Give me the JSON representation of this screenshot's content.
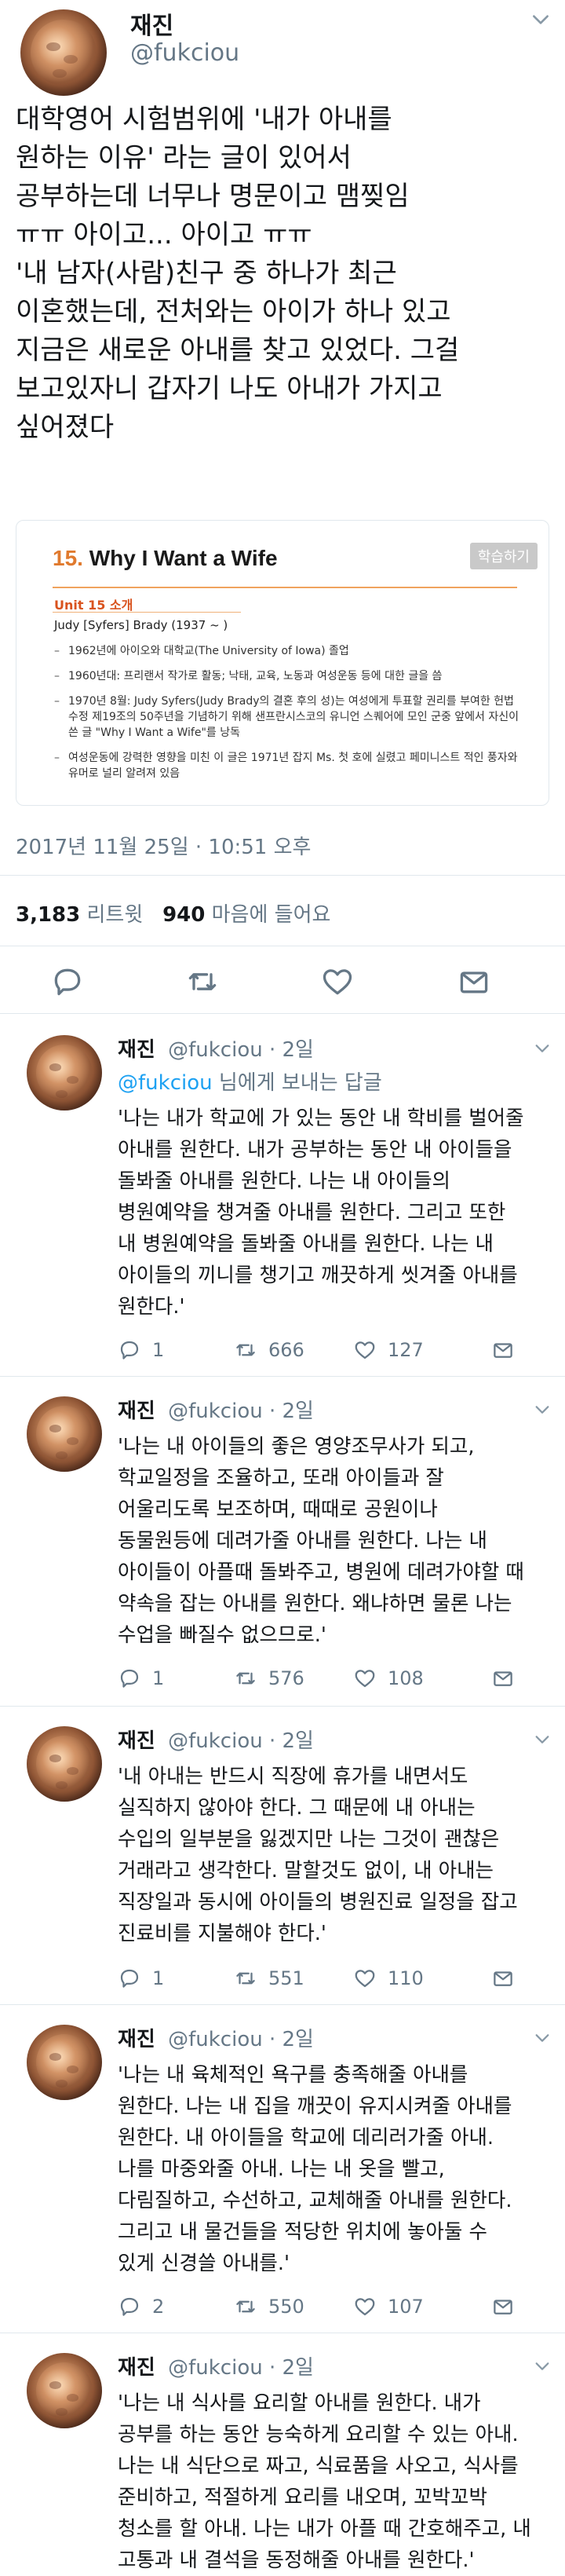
{
  "main_tweet": {
    "name": "재진",
    "handle": "@fukciou",
    "text": "대학영어 시험범위에 '내가 아내를\n원하는 이유' 라는 글이 있어서\n공부하는데 너무나 명문이고 맴찢임\nㅠㅠ 아이고... 아이고 ㅠㅠ\n'내 남자(사람)친구 중 하나가 최근\n이혼했는데, 전처와는 아이가 하나 있고\n지금은 새로운 아내를 찾고 있었다. 그걸\n보고있자니 갑자기 나도 아내가 가지고\n싶어졌다",
    "card": {
      "title_num": "15.",
      "title_text": "Why I Want a Wife",
      "tag": "학습하기",
      "unit": "Unit 15 소개",
      "author": "Judy [Syfers] Brady (1937 ~ )",
      "items": [
        "1962년에 아이오와 대학교(The University of Iowa) 졸업",
        "1960년대: 프리랜서 작가로 활동; 낙태, 교육, 노동과 여성운동 등에 대한 글을 씀",
        "1970년 8월: Judy Syfers(Judy Brady의 결혼 후의 성)는 여성에게 투표할 권리를 부여한 헌법 수정 제19조의 50주년을 기념하기 위해 샌프란시스코의 유니언 스퀘어에 모인 군중 앞에서 자신이 쓴 글 \"Why I Want a Wife\"를 낭독",
        "여성운동에 강력한 영향을 미친 이 글은 1971년 잡지 Ms. 첫 호에 실렸고 페미니스트 적인 풍자와 유머로 널리 알려져 있음"
      ]
    },
    "timestamp": "2017년 11월 25일 · 10:51 오후",
    "retweet_count": "3,183",
    "retweet_label": "리트윗",
    "like_count": "940",
    "like_label": "마음에 들어요"
  },
  "replies": [
    {
      "name": "재진",
      "meta": "@fukciou · 2일",
      "reply_to_mention": "@fukciou",
      "reply_to_suffix": " 님에게 보내는 답글",
      "text": "'나는 내가 학교에 가 있는 동안 내 학비를 벌어줄\n아내를 원한다. 내가 공부하는 동안 내 아이들을\n돌봐줄 아내를 원한다. 나는 내 아이들의\n병원예약을 챙겨줄 아내를 원한다. 그리고 또한\n내 병원예약을 돌봐줄 아내를 원한다. 나는 내\n아이들의 끼니를 챙기고 깨끗하게 씻겨줄 아내를\n원한다.'",
      "replies": "1",
      "retweets": "666",
      "likes": "127"
    },
    {
      "name": "재진",
      "meta": "@fukciou · 2일",
      "text": "'나는 내 아이들의 좋은 영양조무사가 되고,\n학교일정을 조율하고, 또래 아이들과 잘\n어울리도록 보조하며, 때때로 공원이나\n동물원등에 데려가줄 아내를 원한다. 나는 내\n아이들이 아플때 돌봐주고, 병원에 데려가야할 때\n약속을 잡는 아내를 원한다. 왜냐하면 물론 나는\n수업을 빠질수 없으므로.'",
      "replies": "1",
      "retweets": "576",
      "likes": "108"
    },
    {
      "name": "재진",
      "meta": "@fukciou · 2일",
      "text": "'내 아내는 반드시 직장에 휴가를 내면서도\n실직하지 않아야 한다. 그 때문에 내 아내는\n수입의 일부분을 잃겠지만 나는 그것이 괜찮은\n거래라고 생각한다. 말할것도 없이, 내 아내는\n직장일과 동시에 아이들의 병원진료 일정을 잡고\n진료비를 지불해야 한다.'",
      "replies": "1",
      "retweets": "551",
      "likes": "110"
    },
    {
      "name": "재진",
      "meta": "@fukciou · 2일",
      "text": "'나는 내 육체적인 욕구를 충족해줄 아내를\n원한다. 나는 내 집을 깨끗이 유지시켜줄 아내를\n원한다. 내 아이들을 학교에 데리러가줄 아내.\n나를 마중와줄 아내. 나는 내 옷을 빨고,\n다림질하고, 수선하고, 교체해줄 아내를 원한다.\n그리고 내 물건들을 적당한 위치에 놓아둘 수\n있게 신경쓸 아내를.'",
      "replies": "2",
      "retweets": "550",
      "likes": "107"
    },
    {
      "name": "재진",
      "meta": "@fukciou · 2일",
      "text": "'나는 내 식사를 요리할 아내를 원한다. 내가\n공부를 하는 동안 능숙하게 요리할 수 있는 아내.\n나는 내 식단으로 짜고, 식료품을 사오고, 식사를\n준비하고, 적절하게 요리를 내오며, 꼬박꼬박\n청소를 할 아내. 나는 내가 아플 때 간호해주고, 내\n고통과 내 결석을 동정해줄 아내를 원한다.'"
    }
  ],
  "colors": {
    "text": "#14171a",
    "secondary": "#657786",
    "link": "#1da1f2",
    "divider": "#e1e8ed",
    "card_accent": "#e07a2e"
  }
}
